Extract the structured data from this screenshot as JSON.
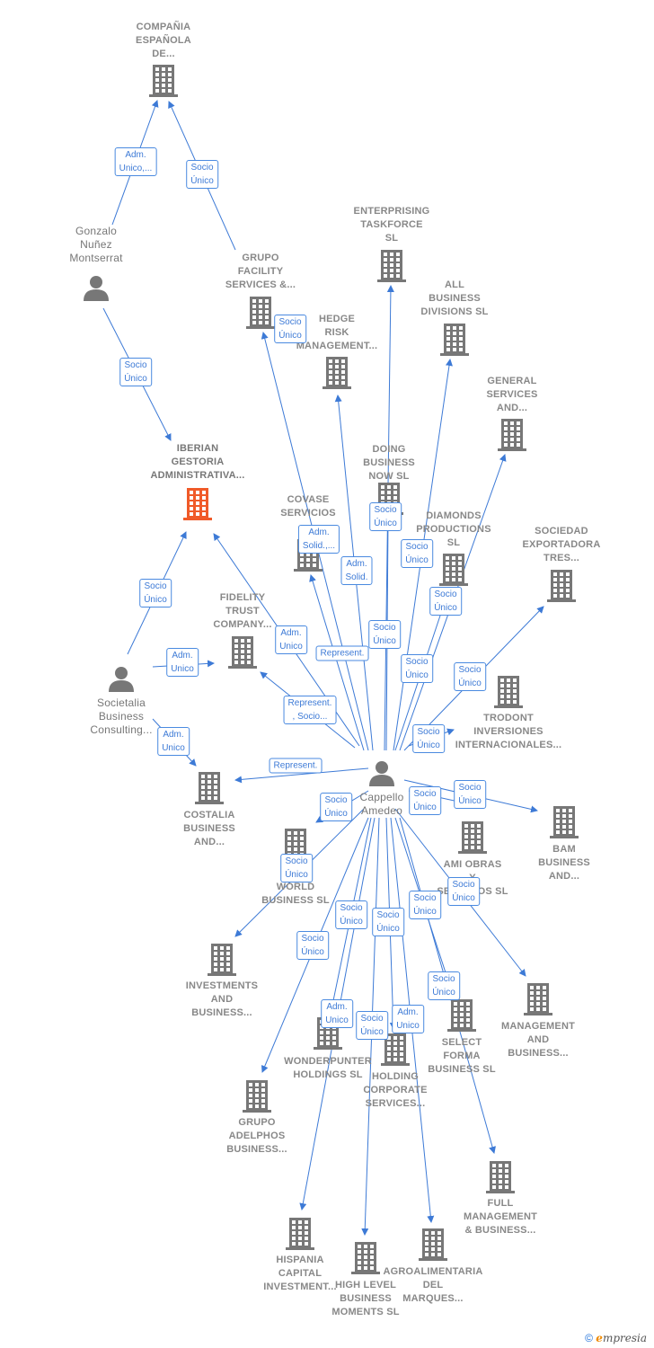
{
  "colors": {
    "edge": "#3d7ad6",
    "company": "#777777",
    "highlight": "#f05a28",
    "person": "#777777"
  },
  "nodes": [
    {
      "id": "compania",
      "type": "company",
      "label": [
        "COMPAÑIA",
        "ESPAÑOLA",
        "DE..."
      ]
    },
    {
      "id": "gonzalo",
      "type": "person",
      "label": [
        "Gonzalo",
        "Nuñez",
        "Montserrat"
      ]
    },
    {
      "id": "facility",
      "type": "company",
      "label": [
        "GRUPO",
        "FACILITY",
        "SERVICES &..."
      ]
    },
    {
      "id": "enterprising",
      "type": "company",
      "label": [
        "ENTERPRISING",
        "TASKFORCE",
        "SL"
      ]
    },
    {
      "id": "allbusiness",
      "type": "company",
      "label": [
        "ALL",
        "BUSINESS",
        "DIVISIONS  SL"
      ]
    },
    {
      "id": "hedge",
      "type": "company",
      "label": [
        "HEDGE",
        "RISK",
        "MANAGEMENT..."
      ]
    },
    {
      "id": "general",
      "type": "company",
      "label": [
        "GENERAL",
        "SERVICES",
        "AND..."
      ]
    },
    {
      "id": "iberian",
      "type": "company",
      "highlight": true,
      "label": [
        "IBERIAN",
        "GESTORIA",
        "ADMINISTRATIVA..."
      ]
    },
    {
      "id": "doing",
      "type": "company",
      "label": [
        "DOING",
        "BUSINESS",
        "NOW  SL"
      ]
    },
    {
      "id": "covase",
      "type": "company",
      "label": [
        "COVASE",
        "SERVICIOS",
        "..."
      ]
    },
    {
      "id": "diamonds",
      "type": "company",
      "label": [
        "DIAMONDS",
        "PRODUCTIONS",
        "SL"
      ]
    },
    {
      "id": "sociedad",
      "type": "company",
      "label": [
        "SOCIEDAD",
        "EXPORTADORA",
        "TRES..."
      ]
    },
    {
      "id": "fidelity",
      "type": "company",
      "label": [
        "FIDELITY",
        "TRUST",
        "COMPANY..."
      ]
    },
    {
      "id": "societalia",
      "type": "person",
      "label": [
        "Societalia",
        "Business",
        "Consulting..."
      ]
    },
    {
      "id": "trodont",
      "type": "company",
      "label": [
        "TRODONT",
        "INVERSIONES",
        "INTERNACIONALES..."
      ]
    },
    {
      "id": "cappello",
      "type": "person",
      "label": [
        "Cappello",
        "Amedeo"
      ]
    },
    {
      "id": "costalia",
      "type": "company",
      "label": [
        "COSTALIA",
        "BUSINESS",
        "AND..."
      ]
    },
    {
      "id": "bam",
      "type": "company",
      "label": [
        "BAM",
        "BUSINESS",
        "AND..."
      ]
    },
    {
      "id": "dworld",
      "type": "company",
      "label": [
        "D...",
        "WORLD",
        "BUSINESS  SL"
      ]
    },
    {
      "id": "ami",
      "type": "company",
      "label": [
        "AMI OBRAS",
        "Y",
        "SERVICIOS  SL"
      ]
    },
    {
      "id": "investments",
      "type": "company",
      "label": [
        "INVESTMENTS",
        "AND",
        "BUSINESS..."
      ]
    },
    {
      "id": "management",
      "type": "company",
      "label": [
        "MANAGEMENT",
        "AND",
        "BUSINESS..."
      ]
    },
    {
      "id": "wonderpunter",
      "type": "company",
      "label": [
        "WONDERPUNTER",
        "HOLDINGS  SL"
      ]
    },
    {
      "id": "holding",
      "type": "company",
      "label": [
        "HOLDING",
        "CORPORATE",
        "SERVICES..."
      ]
    },
    {
      "id": "select",
      "type": "company",
      "label": [
        "SELECT",
        "FORMA",
        "BUSINESS  SL"
      ]
    },
    {
      "id": "adelphos",
      "type": "company",
      "label": [
        "GRUPO",
        "ADELPHOS",
        "BUSINESS..."
      ]
    },
    {
      "id": "full",
      "type": "company",
      "label": [
        "FULL",
        "MANAGEMENT",
        "& BUSINESS..."
      ]
    },
    {
      "id": "hispania",
      "type": "company",
      "label": [
        "HISPANIA",
        "CAPITAL",
        "INVESTMENT..."
      ]
    },
    {
      "id": "highlevel",
      "type": "company",
      "label": [
        "HIGH LEVEL",
        "BUSINESS",
        "MOMENTS  SL"
      ]
    },
    {
      "id": "agro",
      "type": "company",
      "label": [
        "AGROALIMENTARIA",
        "DEL",
        "MARQUES..."
      ]
    }
  ],
  "edge_labels": [
    [
      "Adm.",
      "Unico,..."
    ],
    [
      "Socio",
      "Único"
    ],
    [
      "Socio",
      "Único"
    ],
    [
      "Socio",
      "Único"
    ],
    [
      "Socio",
      "Único"
    ],
    [
      "Adm.",
      "Solid.,..."
    ],
    [
      "Adm.",
      "Solid."
    ],
    [
      "Socio",
      "Único"
    ],
    [
      "Socio",
      "Único"
    ],
    [
      "Socio",
      "Único"
    ],
    [
      "Adm.",
      "Unico"
    ],
    [
      "Adm.",
      "Unico"
    ],
    [
      "Represent."
    ],
    [
      "Socio",
      "Único"
    ],
    [
      "Socio",
      "Único"
    ],
    [
      "Socio",
      "Único"
    ],
    [
      "Represent.",
      ", Socio..."
    ],
    [
      "Adm.",
      "Unico"
    ],
    [
      "Socio",
      "Único"
    ],
    [
      "Represent."
    ],
    [
      "Socio",
      "Único"
    ],
    [
      "Socio",
      "Único"
    ],
    [
      "Socio",
      "Único"
    ],
    [
      "Socio",
      "Único"
    ],
    [
      "Socio",
      "Único"
    ],
    [
      "Socio",
      "Único"
    ],
    [
      "Socio",
      "Único"
    ],
    [
      "Socio",
      "Único"
    ],
    [
      "Socio",
      "Único"
    ],
    [
      "Socio",
      "Único"
    ],
    [
      "Adm.",
      "Unico"
    ],
    [
      "Socio",
      "Único"
    ],
    [
      "Adm.",
      "Unico"
    ]
  ],
  "footer": {
    "copyright": "©",
    "brand_first": "e",
    "brand_rest": "mpresia"
  }
}
